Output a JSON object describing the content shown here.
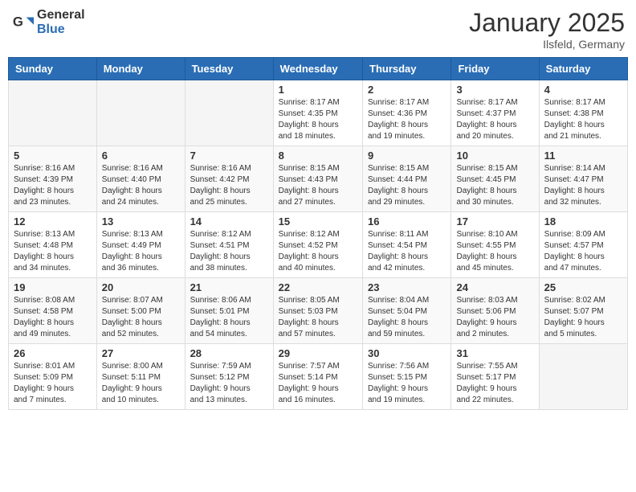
{
  "header": {
    "logo_general": "General",
    "logo_blue": "Blue",
    "month_year": "January 2025",
    "location": "Ilsfeld, Germany"
  },
  "weekdays": [
    "Sunday",
    "Monday",
    "Tuesday",
    "Wednesday",
    "Thursday",
    "Friday",
    "Saturday"
  ],
  "weeks": [
    [
      {
        "day": "",
        "info": ""
      },
      {
        "day": "",
        "info": ""
      },
      {
        "day": "",
        "info": ""
      },
      {
        "day": "1",
        "info": "Sunrise: 8:17 AM\nSunset: 4:35 PM\nDaylight: 8 hours\nand 18 minutes."
      },
      {
        "day": "2",
        "info": "Sunrise: 8:17 AM\nSunset: 4:36 PM\nDaylight: 8 hours\nand 19 minutes."
      },
      {
        "day": "3",
        "info": "Sunrise: 8:17 AM\nSunset: 4:37 PM\nDaylight: 8 hours\nand 20 minutes."
      },
      {
        "day": "4",
        "info": "Sunrise: 8:17 AM\nSunset: 4:38 PM\nDaylight: 8 hours\nand 21 minutes."
      }
    ],
    [
      {
        "day": "5",
        "info": "Sunrise: 8:16 AM\nSunset: 4:39 PM\nDaylight: 8 hours\nand 23 minutes."
      },
      {
        "day": "6",
        "info": "Sunrise: 8:16 AM\nSunset: 4:40 PM\nDaylight: 8 hours\nand 24 minutes."
      },
      {
        "day": "7",
        "info": "Sunrise: 8:16 AM\nSunset: 4:42 PM\nDaylight: 8 hours\nand 25 minutes."
      },
      {
        "day": "8",
        "info": "Sunrise: 8:15 AM\nSunset: 4:43 PM\nDaylight: 8 hours\nand 27 minutes."
      },
      {
        "day": "9",
        "info": "Sunrise: 8:15 AM\nSunset: 4:44 PM\nDaylight: 8 hours\nand 29 minutes."
      },
      {
        "day": "10",
        "info": "Sunrise: 8:15 AM\nSunset: 4:45 PM\nDaylight: 8 hours\nand 30 minutes."
      },
      {
        "day": "11",
        "info": "Sunrise: 8:14 AM\nSunset: 4:47 PM\nDaylight: 8 hours\nand 32 minutes."
      }
    ],
    [
      {
        "day": "12",
        "info": "Sunrise: 8:13 AM\nSunset: 4:48 PM\nDaylight: 8 hours\nand 34 minutes."
      },
      {
        "day": "13",
        "info": "Sunrise: 8:13 AM\nSunset: 4:49 PM\nDaylight: 8 hours\nand 36 minutes."
      },
      {
        "day": "14",
        "info": "Sunrise: 8:12 AM\nSunset: 4:51 PM\nDaylight: 8 hours\nand 38 minutes."
      },
      {
        "day": "15",
        "info": "Sunrise: 8:12 AM\nSunset: 4:52 PM\nDaylight: 8 hours\nand 40 minutes."
      },
      {
        "day": "16",
        "info": "Sunrise: 8:11 AM\nSunset: 4:54 PM\nDaylight: 8 hours\nand 42 minutes."
      },
      {
        "day": "17",
        "info": "Sunrise: 8:10 AM\nSunset: 4:55 PM\nDaylight: 8 hours\nand 45 minutes."
      },
      {
        "day": "18",
        "info": "Sunrise: 8:09 AM\nSunset: 4:57 PM\nDaylight: 8 hours\nand 47 minutes."
      }
    ],
    [
      {
        "day": "19",
        "info": "Sunrise: 8:08 AM\nSunset: 4:58 PM\nDaylight: 8 hours\nand 49 minutes."
      },
      {
        "day": "20",
        "info": "Sunrise: 8:07 AM\nSunset: 5:00 PM\nDaylight: 8 hours\nand 52 minutes."
      },
      {
        "day": "21",
        "info": "Sunrise: 8:06 AM\nSunset: 5:01 PM\nDaylight: 8 hours\nand 54 minutes."
      },
      {
        "day": "22",
        "info": "Sunrise: 8:05 AM\nSunset: 5:03 PM\nDaylight: 8 hours\nand 57 minutes."
      },
      {
        "day": "23",
        "info": "Sunrise: 8:04 AM\nSunset: 5:04 PM\nDaylight: 8 hours\nand 59 minutes."
      },
      {
        "day": "24",
        "info": "Sunrise: 8:03 AM\nSunset: 5:06 PM\nDaylight: 9 hours\nand 2 minutes."
      },
      {
        "day": "25",
        "info": "Sunrise: 8:02 AM\nSunset: 5:07 PM\nDaylight: 9 hours\nand 5 minutes."
      }
    ],
    [
      {
        "day": "26",
        "info": "Sunrise: 8:01 AM\nSunset: 5:09 PM\nDaylight: 9 hours\nand 7 minutes."
      },
      {
        "day": "27",
        "info": "Sunrise: 8:00 AM\nSunset: 5:11 PM\nDaylight: 9 hours\nand 10 minutes."
      },
      {
        "day": "28",
        "info": "Sunrise: 7:59 AM\nSunset: 5:12 PM\nDaylight: 9 hours\nand 13 minutes."
      },
      {
        "day": "29",
        "info": "Sunrise: 7:57 AM\nSunset: 5:14 PM\nDaylight: 9 hours\nand 16 minutes."
      },
      {
        "day": "30",
        "info": "Sunrise: 7:56 AM\nSunset: 5:15 PM\nDaylight: 9 hours\nand 19 minutes."
      },
      {
        "day": "31",
        "info": "Sunrise: 7:55 AM\nSunset: 5:17 PM\nDaylight: 9 hours\nand 22 minutes."
      },
      {
        "day": "",
        "info": ""
      }
    ]
  ]
}
